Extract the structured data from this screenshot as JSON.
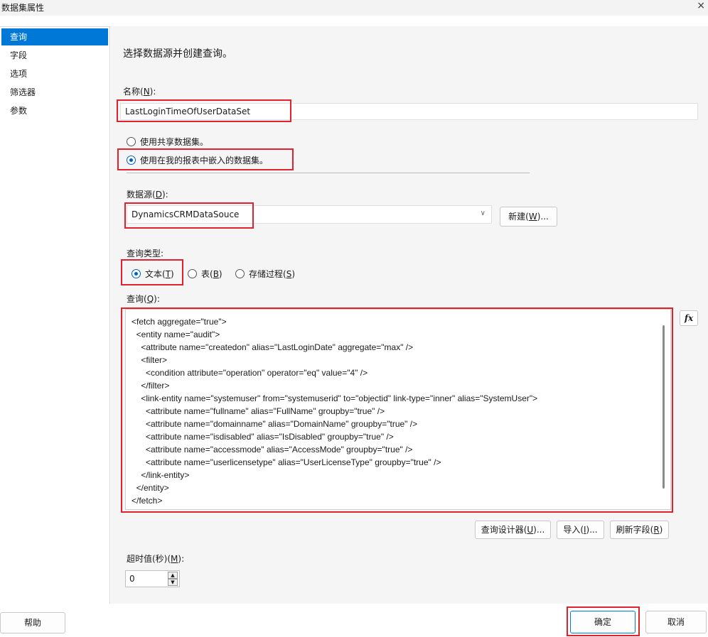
{
  "window": {
    "title": "数据集属性",
    "close": "×"
  },
  "sidebar": {
    "items": [
      {
        "label": "查询"
      },
      {
        "label": "字段"
      },
      {
        "label": "选项"
      },
      {
        "label": "筛选器"
      },
      {
        "label": "参数"
      }
    ]
  },
  "main": {
    "heading": "选择数据源并创建查询。",
    "name_label_prefix": "名称(",
    "name_label_key": "N",
    "name_label_suffix": "):",
    "name_value": "LastLoginTimeOfUserDataSet",
    "radio_shared": "使用共享数据集。",
    "radio_embedded": "使用在我的报表中嵌入的数据集。",
    "datasource_label_prefix": "数据源(",
    "datasource_label_key": "D",
    "datasource_label_suffix": "):",
    "datasource_value": "DynamicsCRMDataSouce",
    "new_button_prefix": "新建(",
    "new_button_key": "W",
    "new_button_suffix": ")...",
    "query_type_label": "查询类型:",
    "query_type_text_prefix": "文本(",
    "query_type_text_key": "T",
    "query_type_text_suffix": ")",
    "query_type_table_prefix": "表(",
    "query_type_table_key": "B",
    "query_type_table_suffix": ")",
    "query_type_sp_prefix": "存储过程(",
    "query_type_sp_key": "S",
    "query_type_sp_suffix": ")",
    "query_label_prefix": "查询(",
    "query_label_key": "Q",
    "query_label_suffix": "):",
    "fx_label": "fx",
    "query_lines": [
      "<fetch aggregate=\"true\">",
      "  <entity name=\"audit\">",
      "    <attribute name=\"createdon\" alias=\"LastLoginDate\" aggregate=\"max\" />",
      "    <filter>",
      "      <condition attribute=\"operation\" operator=\"eq\" value=\"4\" />",
      "    </filter>",
      "    <link-entity name=\"systemuser\" from=\"systemuserid\" to=\"objectid\" link-type=\"inner\" alias=\"SystemUser\">",
      "      <attribute name=\"fullname\" alias=\"FullName\" groupby=\"true\" />",
      "      <attribute name=\"domainname\" alias=\"DomainName\" groupby=\"true\" />",
      "      <attribute name=\"isdisabled\" alias=\"IsDisabled\" groupby=\"true\" />",
      "      <attribute name=\"accessmode\" alias=\"AccessMode\" groupby=\"true\" />",
      "      <attribute name=\"userlicensetype\" alias=\"UserLicenseType\" groupby=\"true\" />",
      "    </link-entity>",
      "  </entity>",
      "</fetch>"
    ],
    "designer_prefix": "查询设计器(",
    "designer_key": "U",
    "designer_suffix": ")...",
    "import_prefix": "导入(",
    "import_key": "I",
    "import_suffix": ")...",
    "refresh_prefix": "刷新字段(",
    "refresh_key": "R",
    "refresh_suffix": ")",
    "timeout_label_prefix": "超时值(秒)(",
    "timeout_label_key": "M",
    "timeout_label_suffix": "):",
    "timeout_value": "0",
    "spin_up": "▲",
    "spin_down": "▼"
  },
  "footer": {
    "help": "帮助",
    "ok": "确定",
    "cancel": "取消"
  },
  "colors": {
    "accent": "#0078d7",
    "highlight": "#e0212e"
  }
}
